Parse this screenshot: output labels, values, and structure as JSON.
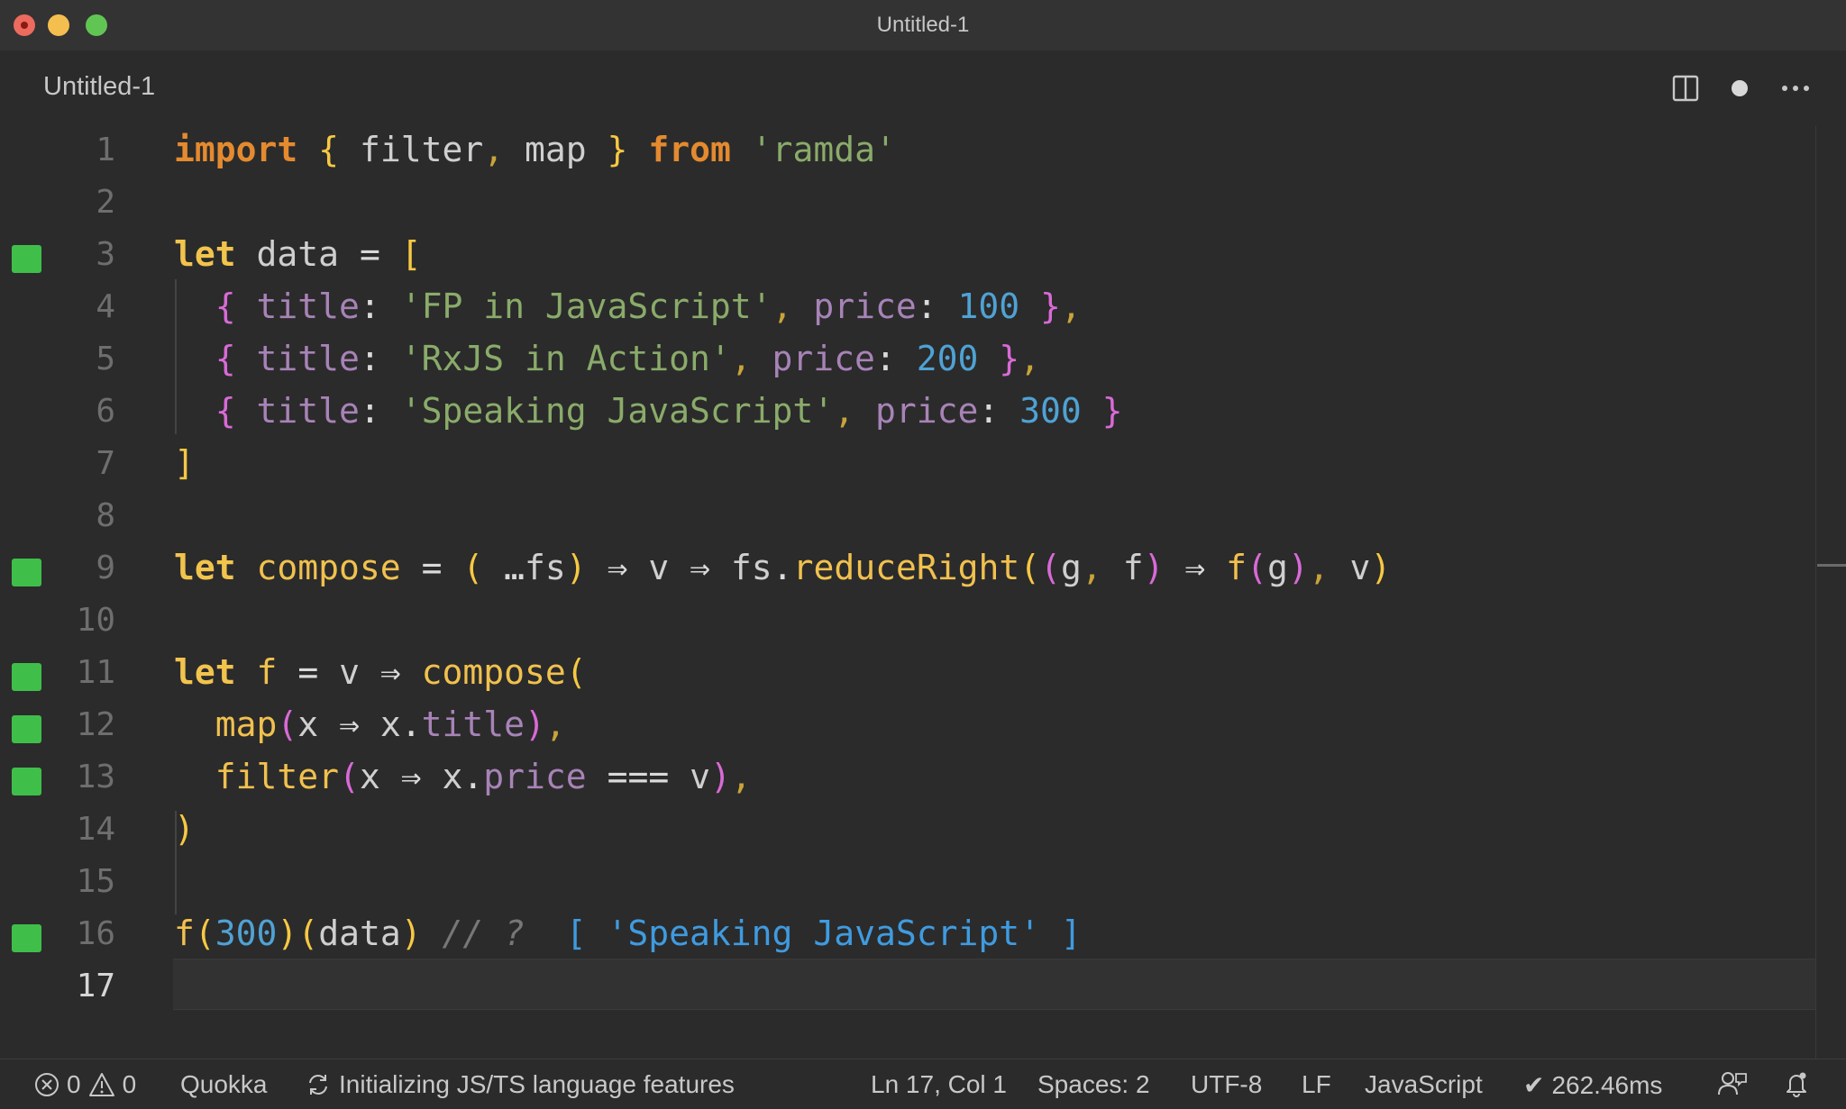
{
  "window": {
    "title": "Untitled-1"
  },
  "tab": {
    "label": "Untitled-1"
  },
  "editor": {
    "line_numbers": [
      "1",
      "2",
      "3",
      "4",
      "5",
      "6",
      "7",
      "8",
      "9",
      "10",
      "11",
      "12",
      "13",
      "14",
      "15",
      "16",
      "17"
    ],
    "current_line": "17",
    "quokka_markers": [
      "3",
      "9",
      "11",
      "12",
      "13",
      "16"
    ],
    "tokens": {
      "l1": [
        "import",
        "{",
        "filter",
        ",",
        "map",
        "}",
        "from",
        "'ramda'"
      ],
      "l3": [
        "let",
        "data",
        "=",
        "["
      ],
      "l4": [
        "{",
        "title",
        ":",
        "'FP in JavaScript'",
        ",",
        "price",
        ":",
        "100",
        "}",
        ","
      ],
      "l5": [
        "{",
        "title",
        ":",
        "'RxJS in Action'",
        ",",
        "price",
        ":",
        "200",
        "}",
        ","
      ],
      "l6": [
        "{",
        "title",
        ":",
        "'Speaking JavaScript'",
        ",",
        "price",
        ":",
        "300",
        "}"
      ],
      "l7": [
        "]"
      ],
      "l9": [
        "let",
        "compose",
        "=",
        "(",
        "…",
        "fs",
        ")",
        "⇒",
        "v",
        "⇒",
        "fs",
        ".",
        "reduceRight",
        "(",
        "(",
        "g",
        ",",
        "f",
        ")",
        "⇒",
        "f",
        "(",
        "g",
        ")",
        ",",
        "v",
        ")"
      ],
      "l11": [
        "let",
        "f",
        "=",
        "v",
        "⇒",
        "compose",
        "("
      ],
      "l12": [
        "map",
        "(",
        "x",
        "⇒",
        "x",
        ".",
        "title",
        ")",
        ","
      ],
      "l13": [
        "filter",
        "(",
        "x",
        "⇒",
        "x",
        ".",
        "price",
        "===",
        "v",
        ")",
        ","
      ],
      "l14": [
        ")"
      ],
      "l16": [
        "f",
        "(",
        "300",
        ")",
        "(",
        "data",
        ")",
        "// ?",
        "[ 'Speaking JavaScript' ]"
      ]
    }
  },
  "statusbar": {
    "errors": "0",
    "warnings": "0",
    "quokka": "Quokka",
    "language_status": "Initializing JS/TS language features",
    "cursor": "Ln 17, Col 1",
    "indent": "Spaces: 2",
    "encoding": "UTF-8",
    "eol": "LF",
    "language": "JavaScript",
    "timing": "262.46ms"
  },
  "colors": {
    "background": "#2b2b2b",
    "keyword": "#e48a2f",
    "string": "#8aab6a",
    "number": "#4fa2d4",
    "property": "#a783b7",
    "quokka_marker": "#3fbf4a",
    "inline_result": "#3f9be0"
  },
  "icons": [
    "close-window-icon",
    "minimize-window-icon",
    "maximize-window-icon",
    "split-editor-icon",
    "unsaved-dot-icon",
    "more-actions-icon",
    "error-icon",
    "warning-icon",
    "sync-icon",
    "check-icon",
    "feedback-icon",
    "bell-icon"
  ]
}
